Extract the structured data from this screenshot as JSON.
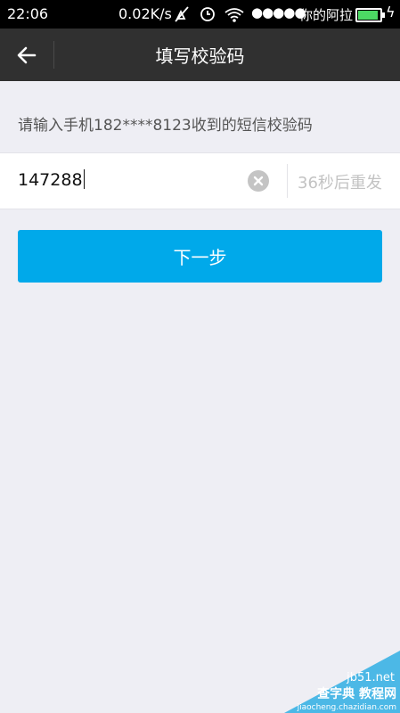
{
  "status_bar": {
    "time": "22:06",
    "speed": "0.02K/s",
    "signal": "●●●●●",
    "carrier": "你的阿拉",
    "battery_level": 0.9
  },
  "header": {
    "title": "填写校验码"
  },
  "hint": "请输入手机182****8123收到的短信校验码",
  "code_field": {
    "value": "147288",
    "resend_label": "36秒后重发"
  },
  "next_button": {
    "label": "下一步"
  },
  "watermark": {
    "site": "jb51.net",
    "text": "查字典 教程网",
    "url": "jiaocheng.chazidian.com"
  },
  "colors": {
    "accent": "#00a9ea",
    "title_bar": "#303030",
    "background": "#eeeef4"
  }
}
